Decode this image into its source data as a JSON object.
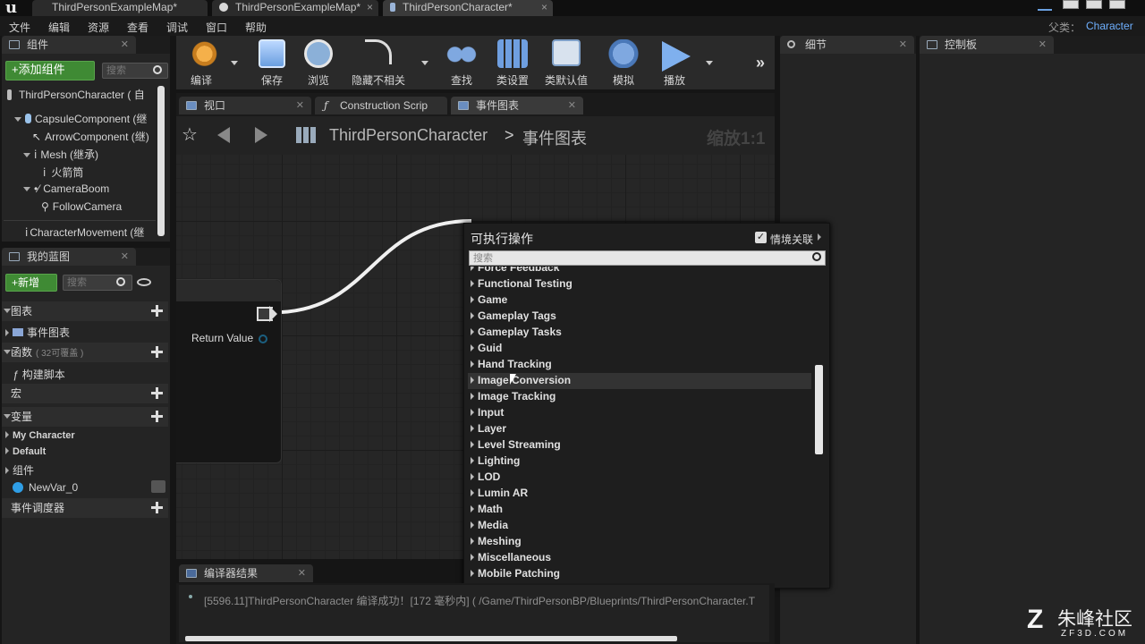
{
  "title_bar": {
    "logo": "u",
    "tabs": [
      {
        "label": "ThirdPersonExampleMap*"
      },
      {
        "label": "ThirdPersonExampleMap*"
      },
      {
        "label": "ThirdPersonCharacter*"
      }
    ],
    "parent_label": "父类：",
    "parent_value": "Character"
  },
  "menu": [
    "文件",
    "编辑",
    "资源",
    "查看",
    "调试",
    "窗口",
    "帮助"
  ],
  "components_panel": {
    "tab": "组件",
    "add_button": "+添加组件",
    "search_placeholder": "搜索",
    "root": "ThirdPersonCharacter ( 自",
    "items": [
      "CapsuleComponent (继",
      "ArrowComponent (继)",
      "Mesh (继承)",
      "火箭筒",
      "CameraBoom",
      "FollowCamera",
      "CharacterMovement (继"
    ]
  },
  "my_blueprint_panel": {
    "tab": "我的蓝图",
    "new_button": "+新增",
    "search_placeholder": "搜索",
    "graphs_header": "图表",
    "event_graph": "事件图表",
    "functions_header": "函数",
    "functions_note": "( 32可覆盖 )",
    "construction_script": "构建脚本",
    "macros_header": "宏",
    "variables_header": "变量",
    "var_groups": [
      "My Character",
      "Default",
      "组件"
    ],
    "variable": "NewVar_0",
    "dispatchers_header": "事件调度器"
  },
  "toolbar": {
    "buttons": [
      "编译",
      "保存",
      "浏览",
      "隐藏不相关",
      "查找",
      "类设置",
      "类默认值",
      "模拟",
      "播放"
    ]
  },
  "editor_tabs": [
    "视口",
    "Construction Scrip",
    "事件图表"
  ],
  "breadcrumb": {
    "blueprint": "ThirdPersonCharacter",
    "separator": ">",
    "graph": "事件图表",
    "zoom": "缩放1:1"
  },
  "node": {
    "pin_label": "Return Value"
  },
  "right_panels": {
    "details_tab": "细节",
    "palette_tab": "控制板"
  },
  "action_menu": {
    "title": "可执行操作",
    "context_label": "情境关联",
    "search_placeholder": "搜索",
    "partial_top": "Force Feedback",
    "items": [
      "Functional Testing",
      "Gameplay Tags",
      "Gameplay Tasks",
      "Game",
      "Guid",
      "Hand Tracking",
      "Image Conversion",
      "Image Tracking",
      "Input",
      "Layer",
      "Level Streaming",
      "Lighting",
      "LOD",
      "Lumin AR",
      "Math",
      "Media",
      "Meshing",
      "Miscellaneous",
      "Mobile Patching"
    ]
  },
  "compiler": {
    "tab": "编译器结果",
    "message": "[5596.11]ThirdPersonCharacter 编译成功！[172 毫秒内] ( /Game/ThirdPersonBP/Blueprints/ThirdPersonCharacter.T"
  },
  "watermark": {
    "brand": "朱峰社区",
    "site": "ZF3D.COM"
  }
}
